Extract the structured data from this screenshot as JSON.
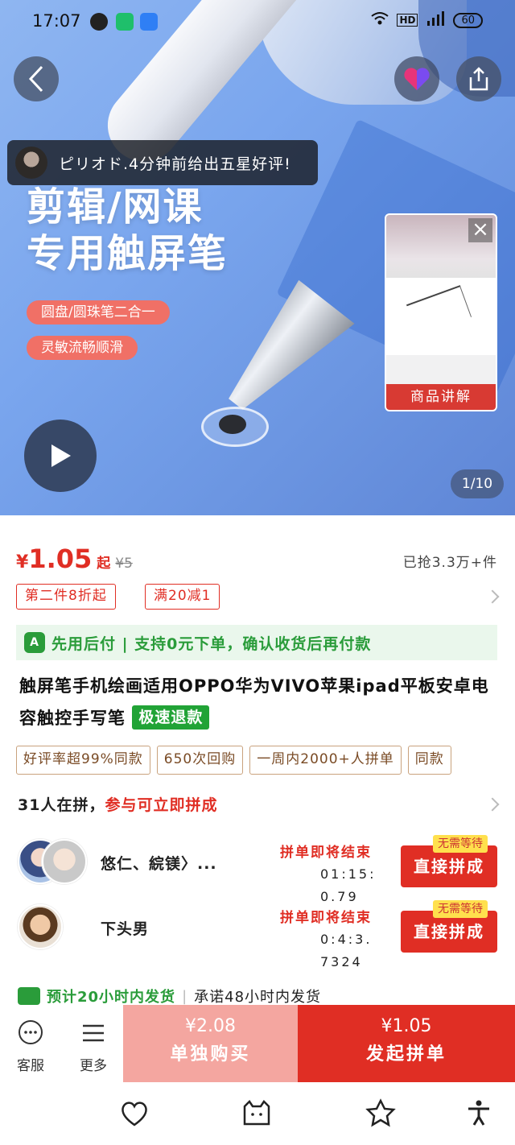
{
  "status_bar": {
    "time": "17:07",
    "signal_text": "HD",
    "battery": "60"
  },
  "hero": {
    "toast_text": "ピリオド.4分钟前给出五星好评!",
    "headline_line1": "剪辑/网课",
    "headline_line2": "专用触屏笔",
    "tag1": "圆盘/圆珠笔二合一",
    "tag2": "灵敏流畅顺滑",
    "video_label": "商品讲解",
    "page_indicator": "1/10"
  },
  "product": {
    "price_symbol": "¥",
    "price": "1.05",
    "price_from": "起",
    "original_price": "¥5",
    "sold": "已抢3.3万+件",
    "promos": [
      "第二件8折起",
      "满20减1"
    ],
    "bnpl": "先用后付 | 支持0元下单，确认收货后再付款",
    "title": "触屏笔手机绘画适用OPPO华为VIVO苹果ipad平板安卓电容触控手写笔",
    "fast_refund": "极速退款",
    "tags": [
      "好评率超99%同款",
      "650次回购",
      "一周内2000+人拼单",
      "同款"
    ]
  },
  "group": {
    "head_prefix": "31人在拼，",
    "head_highlight": "参与可立即拼成",
    "rows": [
      {
        "name": "悠仁、綄镁〉...",
        "status": "拼单即将结束",
        "timer": "01:15:0.79",
        "button": "直接拼成",
        "badge": "无需等待"
      },
      {
        "name": "下头男",
        "status": "拼单即将结束",
        "timer": "0:4:3.7324",
        "button": "直接拼成",
        "badge": "无需等待"
      }
    ]
  },
  "shipping": {
    "main": "预计20小时内发货",
    "sub": "承诺48小时内发货"
  },
  "action_bar": {
    "service": "客服",
    "more": "更多",
    "solo_price": "¥2.08",
    "solo_label": "单独购买",
    "group_price": "¥1.05",
    "group_label": "发起拼单"
  },
  "colors": {
    "accent": "#e02e24",
    "green": "#2a9c3a",
    "hero_bg": "#7aa6ee"
  }
}
